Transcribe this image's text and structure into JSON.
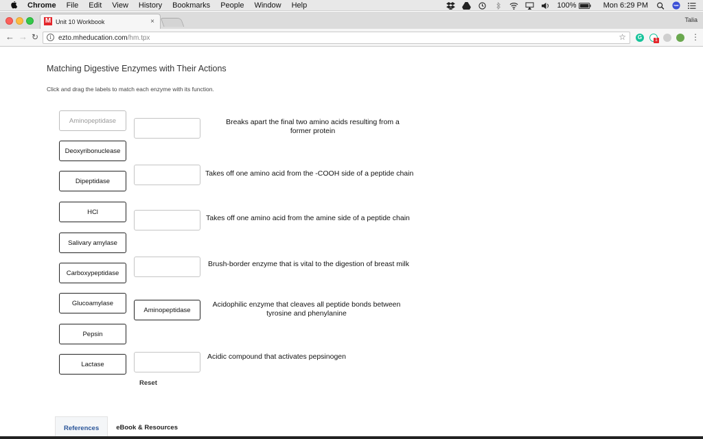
{
  "menubar": {
    "app": "Chrome",
    "items": [
      "File",
      "Edit",
      "View",
      "History",
      "Bookmarks",
      "People",
      "Window",
      "Help"
    ],
    "battery": "100%",
    "clock": "Mon 6:29 PM"
  },
  "browser": {
    "tab_title": "Unit 10 Workbook",
    "tab_close": "×",
    "favicon_letter": "M",
    "profile_name": "Talia",
    "url_host": "ezto.mheducation.com",
    "url_path": "/hm.tpx",
    "ext_badge": "1"
  },
  "activity": {
    "title": "Matching Digestive Enzymes with Their Actions",
    "instructions": "Click and drag the labels to match each enzyme with its function.",
    "labels": [
      {
        "text": "Aminopeptidase",
        "placed": true
      },
      {
        "text": "Deoxyribonuclease",
        "placed": false
      },
      {
        "text": "Dipeptidase",
        "placed": false
      },
      {
        "text": "HCl",
        "placed": false
      },
      {
        "text": "Salivary amylase",
        "placed": false
      },
      {
        "text": "Carboxypeptidase",
        "placed": false
      },
      {
        "text": "Glucoamylase",
        "placed": false
      },
      {
        "text": "Pepsin",
        "placed": false
      },
      {
        "text": "Lactase",
        "placed": false
      }
    ],
    "targets": [
      {
        "answer": "",
        "description_lines": [
          "Breaks apart the final two amino acids resulting from a",
          "former protein"
        ]
      },
      {
        "answer": "",
        "description_lines": [
          "Takes off one amino acid from the -COOH side of a peptide chain"
        ]
      },
      {
        "answer": "",
        "description_lines": [
          "Takes off one amino acid from the amine side of a peptide chain"
        ]
      },
      {
        "answer": "",
        "description_lines": [
          "Brush-border enzyme that is vital to the digestion of breast milk"
        ]
      },
      {
        "answer": "Aminopeptidase",
        "description_lines": [
          "Acidophilic enzyme that cleaves all peptide bonds between",
          "tyrosine and phenylanine"
        ]
      },
      {
        "answer": "",
        "description_lines": [
          "Acidic compound that activates pepsinogen"
        ]
      }
    ],
    "reset_label": "Reset"
  },
  "bottom_tabs": [
    "References",
    "eBook & Resources"
  ],
  "colors": {
    "close": "#fc605b",
    "minimize": "#fdbc40",
    "zoom": "#34c84a",
    "brand_red": "#e3262b",
    "active_tab_text": "#2a5599"
  }
}
